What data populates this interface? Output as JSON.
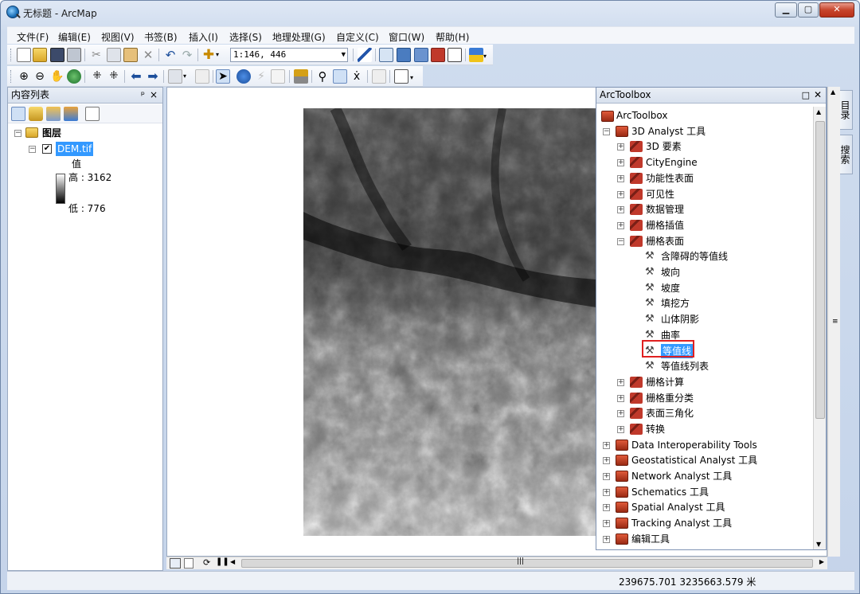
{
  "window": {
    "title": "无标题 - ArcMap"
  },
  "menus": [
    "文件(F)",
    "编辑(E)",
    "视图(V)",
    "书签(B)",
    "插入(I)",
    "选择(S)",
    "地理处理(G)",
    "自定义(C)",
    "窗口(W)",
    "帮助(H)"
  ],
  "toolbar": {
    "scale_value": "1:146, 446"
  },
  "toc": {
    "title": "内容列表",
    "pin": "ᵖ",
    "close": "×",
    "layers_group": "图层",
    "layer_name": "DEM.tif",
    "legend_label": "值",
    "high": "高 : 3162",
    "low": "低 : 776"
  },
  "toolbox": {
    "title": "ArcToolbox",
    "root": "ArcToolbox",
    "items": [
      {
        "label": "3D Analyst 工具",
        "level": 0,
        "expanded": true,
        "type": "toolbox"
      },
      {
        "label": "3D 要素",
        "level": 1,
        "expanded": false,
        "type": "toolset"
      },
      {
        "label": "CityEngine",
        "level": 1,
        "expanded": false,
        "type": "toolset"
      },
      {
        "label": "功能性表面",
        "level": 1,
        "expanded": false,
        "type": "toolset"
      },
      {
        "label": "可见性",
        "level": 1,
        "expanded": false,
        "type": "toolset"
      },
      {
        "label": "数据管理",
        "level": 1,
        "expanded": false,
        "type": "toolset"
      },
      {
        "label": "栅格插值",
        "level": 1,
        "expanded": false,
        "type": "toolset"
      },
      {
        "label": "栅格表面",
        "level": 1,
        "expanded": true,
        "type": "toolset"
      },
      {
        "label": "含障碍的等值线",
        "level": 2,
        "type": "tool"
      },
      {
        "label": "坡向",
        "level": 2,
        "type": "tool"
      },
      {
        "label": "坡度",
        "level": 2,
        "type": "tool"
      },
      {
        "label": "填挖方",
        "level": 2,
        "type": "tool"
      },
      {
        "label": "山体阴影",
        "level": 2,
        "type": "tool"
      },
      {
        "label": "曲率",
        "level": 2,
        "type": "tool"
      },
      {
        "label": "等值线",
        "level": 2,
        "type": "tool",
        "selected": true
      },
      {
        "label": "等值线列表",
        "level": 2,
        "type": "tool"
      },
      {
        "label": "栅格计算",
        "level": 1,
        "expanded": false,
        "type": "toolset"
      },
      {
        "label": "栅格重分类",
        "level": 1,
        "expanded": false,
        "type": "toolset"
      },
      {
        "label": "表面三角化",
        "level": 1,
        "expanded": false,
        "type": "toolset"
      },
      {
        "label": "转换",
        "level": 1,
        "expanded": false,
        "type": "toolset"
      },
      {
        "label": "Data Interoperability Tools",
        "level": 0,
        "expanded": false,
        "type": "toolbox"
      },
      {
        "label": "Geostatistical Analyst 工具",
        "level": 0,
        "expanded": false,
        "type": "toolbox"
      },
      {
        "label": "Network Analyst 工具",
        "level": 0,
        "expanded": false,
        "type": "toolbox"
      },
      {
        "label": "Schematics 工具",
        "level": 0,
        "expanded": false,
        "type": "toolbox"
      },
      {
        "label": "Spatial Analyst 工具",
        "level": 0,
        "expanded": false,
        "type": "toolbox"
      },
      {
        "label": "Tracking Analyst 工具",
        "level": 0,
        "expanded": false,
        "type": "toolbox"
      },
      {
        "label": "编辑工具",
        "level": 0,
        "expanded": false,
        "type": "toolbox"
      }
    ]
  },
  "side_tabs": [
    "目录",
    "搜索"
  ],
  "status": {
    "coords": "239675.701  3235663.579 米"
  },
  "colors": {
    "selection": "#3399ff",
    "highlight_box": "#e02020"
  }
}
